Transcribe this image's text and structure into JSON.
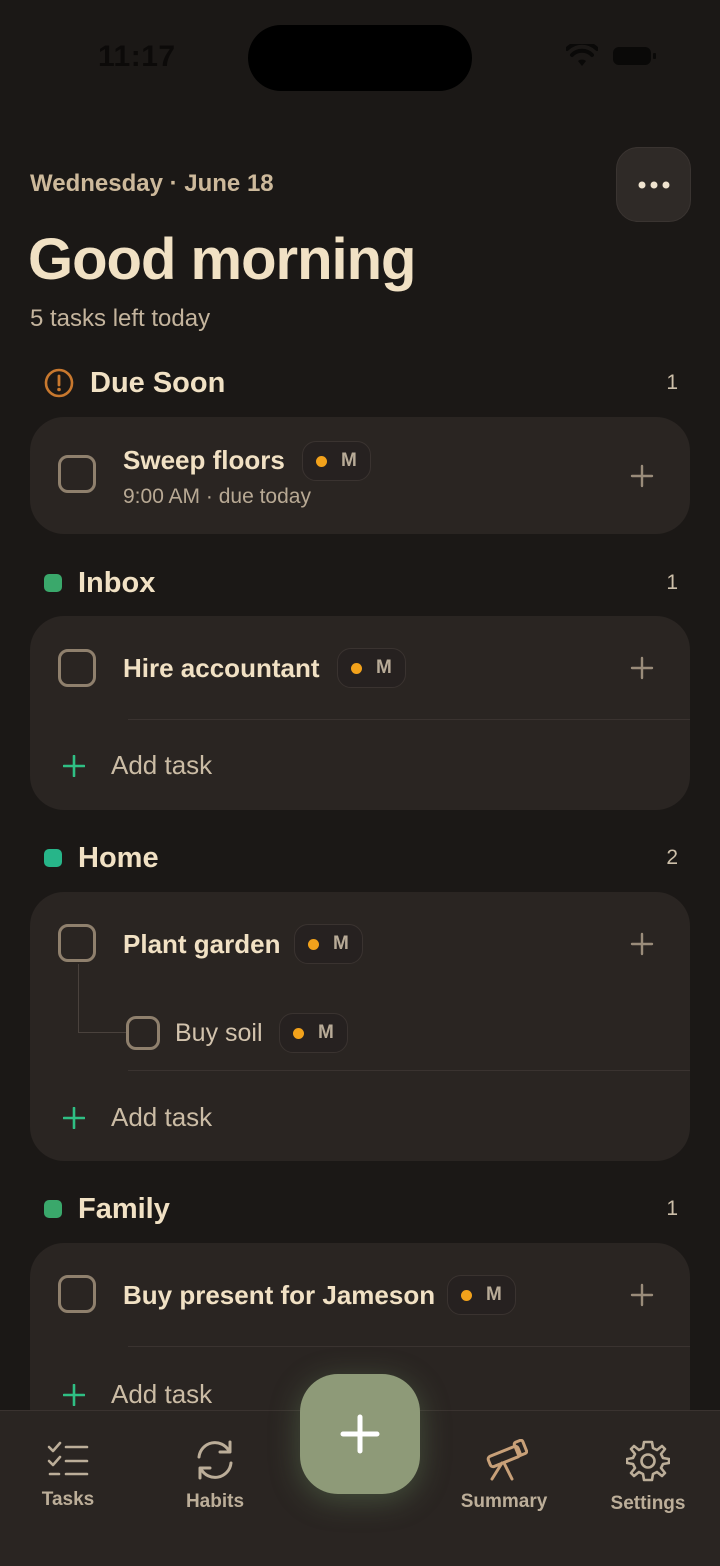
{
  "status_bar": {
    "time": "11:17"
  },
  "header": {
    "date": "Wednesday · June 18",
    "greeting": "Good morning",
    "tasks_left": "5 tasks left today"
  },
  "sections": {
    "due_soon": {
      "title": "Due Soon",
      "count": "1",
      "icon": "alert-circle-icon",
      "tasks": [
        {
          "title": "Sweep floors",
          "priority": "M",
          "meta": "9:00 AM · due today"
        }
      ]
    },
    "inbox": {
      "title": "Inbox",
      "count": "1",
      "color": "#3aa86b",
      "tasks": [
        {
          "title": "Hire accountant",
          "priority": "M"
        }
      ],
      "add_label": "Add task"
    },
    "home": {
      "title": "Home",
      "count": "2",
      "color": "#27b589",
      "tasks": [
        {
          "title": "Plant garden",
          "priority": "M",
          "subtasks": [
            {
              "title": "Buy soil",
              "priority": "M"
            }
          ]
        }
      ],
      "add_label": "Add task"
    },
    "family": {
      "title": "Family",
      "count": "1",
      "color": "#3aa86b",
      "tasks": [
        {
          "title": "Buy present for Jameson",
          "priority": "M"
        }
      ],
      "add_label": "Add task"
    }
  },
  "colors": {
    "accent_green": "#2fbf84",
    "priority_dot": "#f2a21b",
    "warning": "#c8782e",
    "fab": "#8e9a78"
  },
  "tabbar": {
    "tasks": "Tasks",
    "habits": "Habits",
    "summary": "Summary",
    "settings": "Settings"
  }
}
